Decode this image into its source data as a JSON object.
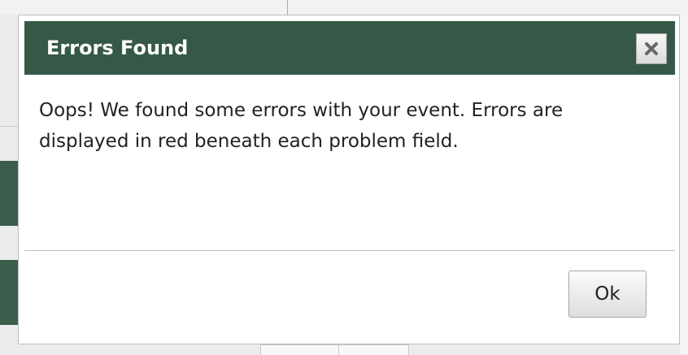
{
  "dialog": {
    "title": "Errors Found",
    "message": "Oops! We found some errors with your event. Errors are displayed in red beneath each problem field.",
    "close_icon": "close-icon",
    "ok_label": "Ok"
  },
  "colors": {
    "header_bg": "#355946",
    "header_text": "#ffffff",
    "body_text": "#222222",
    "error_red": "#d65151"
  }
}
